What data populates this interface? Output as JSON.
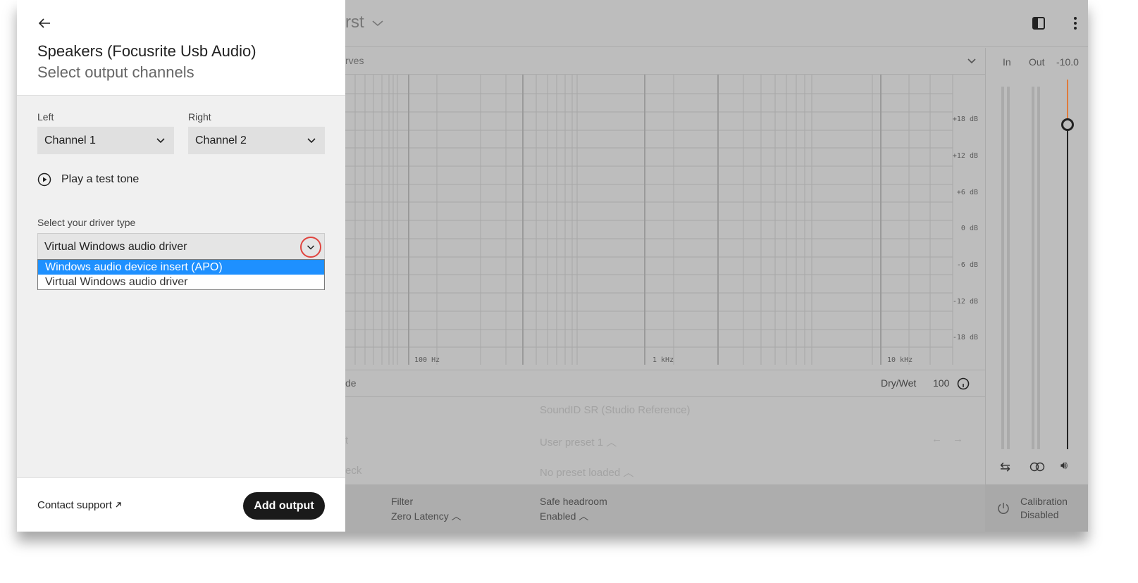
{
  "panel": {
    "title": "Speakers (Focusrite Usb Audio)",
    "subtitle": "Select output channels",
    "left_label": "Left",
    "left_value": "Channel 1",
    "right_label": "Right",
    "right_value": "Channel 2",
    "test_tone_label": "Play a test tone",
    "driver_label": "Select your driver type",
    "driver_value": "Virtual Windows audio driver",
    "driver_options": [
      "Windows audio device insert (APO)",
      "Virtual Windows audio driver"
    ],
    "driver_highlighted": "Windows audio device insert (APO)",
    "contact_label": "Contact support",
    "add_output_label": "Add output"
  },
  "background_app": {
    "title_fragment": "rst",
    "curves_fragment": "rves",
    "db_labels": [
      "+18 dB",
      "+12 dB",
      "+6 dB",
      "0 dB",
      "-6 dB",
      "-12 dB",
      "-18 dB"
    ],
    "hz_labels": [
      "100 Hz",
      "1 kHz",
      "10 kHz"
    ],
    "mode_fragment": "de",
    "dry_wet_label": "Dry/Wet",
    "dry_wet_value": "100",
    "target_value": "SoundID SR (Studio Reference)",
    "preset_fragment": "t",
    "preset_value": "User preset 1",
    "check_fragment": "eck",
    "check_value": "No preset loaded",
    "filter_label": "Filter",
    "filter_value": "Zero Latency",
    "headroom_label": "Safe headroom",
    "headroom_value": "Enabled",
    "meter_in": "In",
    "meter_out": "Out",
    "meter_level": "-10.0",
    "calibration_label": "Calibration",
    "calibration_value": "Disabled"
  },
  "colors": {
    "highlight": "#1e90ff",
    "accent_ring": "#e0443e",
    "primary_button": "#1a1a1a",
    "level_accent": "#e07a3a"
  }
}
